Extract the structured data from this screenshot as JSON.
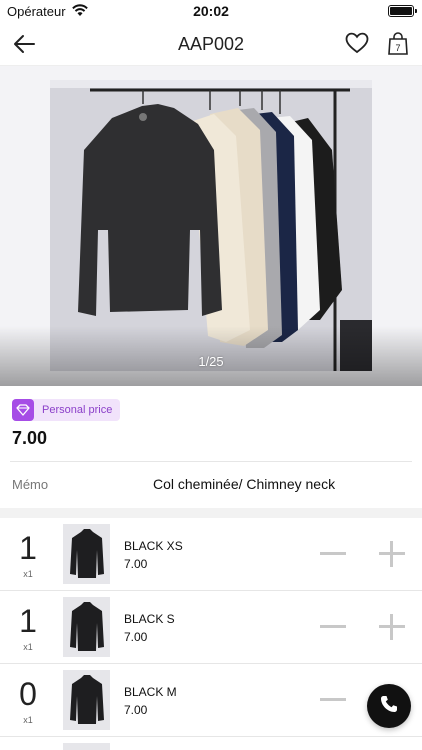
{
  "status_bar": {
    "carrier": "Opérateur",
    "time": "20:02"
  },
  "header": {
    "title": "AAP002",
    "bag_count": "7"
  },
  "gallery": {
    "counter": "1/25"
  },
  "pricing": {
    "badge_label": "Personal price",
    "price": "7.00"
  },
  "memo": {
    "label": "Mémo",
    "value": "Col cheminée/ Chimney neck"
  },
  "variants": [
    {
      "qty": "1",
      "multiplier": "x1",
      "name": "BLACK XS",
      "price": "7.00"
    },
    {
      "qty": "1",
      "multiplier": "x1",
      "name": "BLACK S",
      "price": "7.00"
    },
    {
      "qty": "0",
      "multiplier": "x1",
      "name": "BLACK M",
      "price": "7.00"
    }
  ],
  "colors": {
    "accent_purple": "#a64de6",
    "badge_bg": "#f1e3fb",
    "call_button": "#111111"
  },
  "icons": {
    "back": "arrow-left-icon",
    "favorite": "heart-icon",
    "cart": "shopping-bag-icon",
    "call": "phone-icon",
    "wifi": "wifi-icon",
    "battery": "battery-icon"
  }
}
